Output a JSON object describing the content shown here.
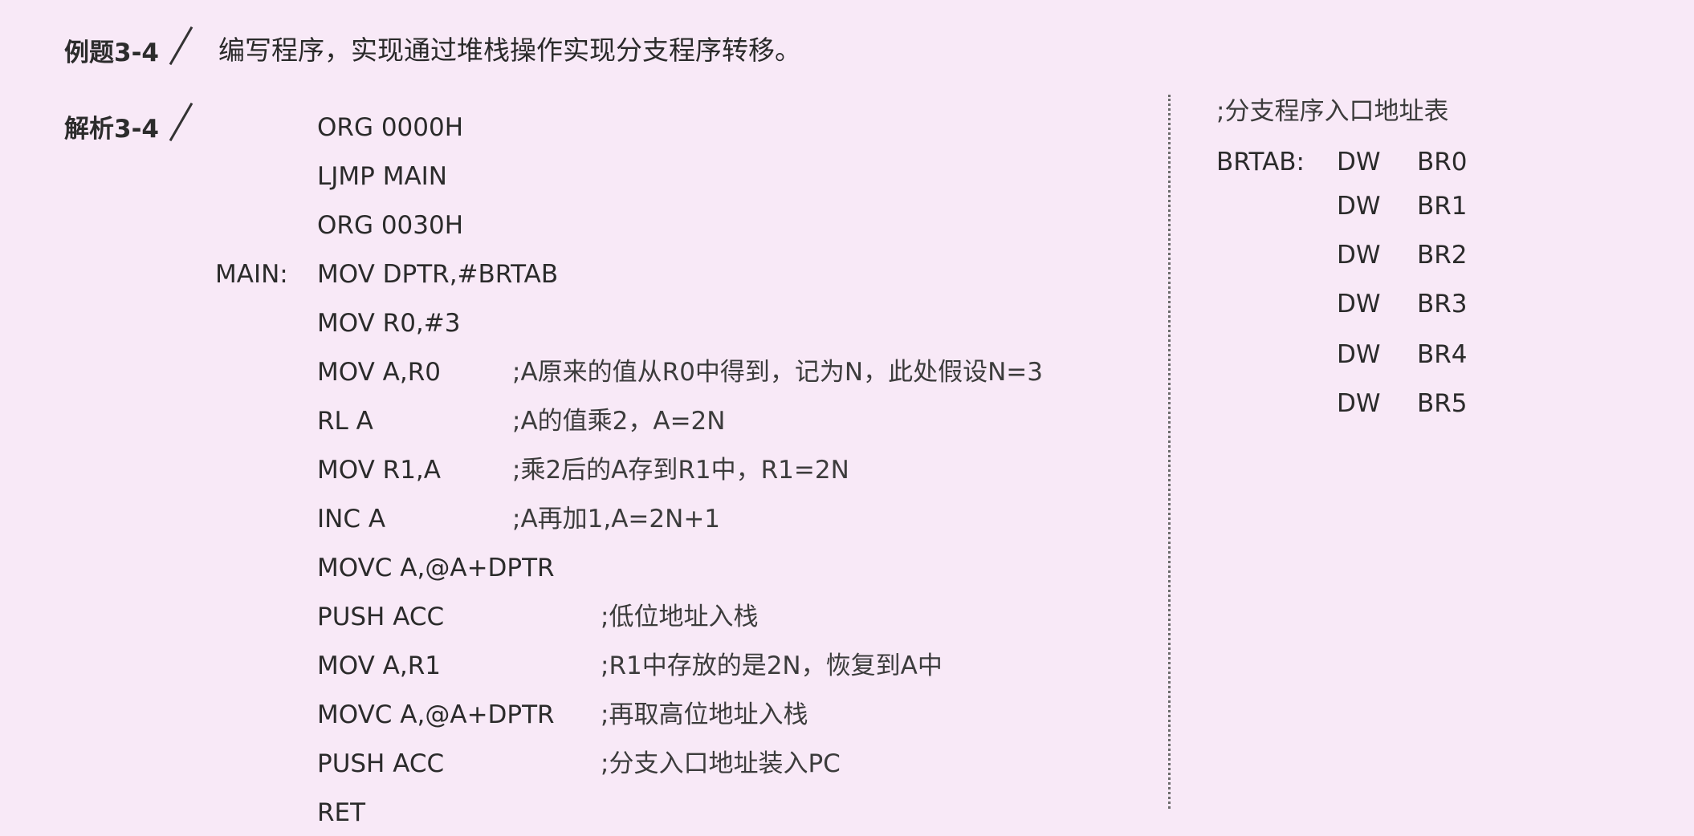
{
  "header": {
    "example_label": "例题3-4",
    "title": "编写程序，实现通过堆栈操作实现分支程序转移。"
  },
  "analysis": {
    "label": "解析3-4"
  },
  "program": {
    "lines": [
      {
        "label": "",
        "instr": "ORG 0000H",
        "comment": ""
      },
      {
        "label": "",
        "instr": "LJMP MAIN",
        "comment": ""
      },
      {
        "label": "",
        "instr": "ORG 0030H",
        "comment": ""
      },
      {
        "label": "MAIN:",
        "instr": "MOV DPTR,#BRTAB",
        "comment": ""
      },
      {
        "label": "",
        "instr": "MOV R0,#3",
        "comment": ""
      },
      {
        "label": "",
        "instr": "MOV A,R0",
        "comment": ";A原来的值从R0中得到，记为N，此处假设N=3"
      },
      {
        "label": "",
        "instr": "RL A",
        "comment": ";A的值乘2，A=2N"
      },
      {
        "label": "",
        "instr": "MOV R1,A",
        "comment": ";乘2后的A存到R1中，R1=2N"
      },
      {
        "label": "",
        "instr": "INC A",
        "comment": ";A再加1,A=2N+1"
      },
      {
        "label": "",
        "instr": "MOVC A,@A+DPTR",
        "comment": ""
      },
      {
        "label": "",
        "instr": "PUSH  ACC",
        "comment": ";低位地址入栈"
      },
      {
        "label": "",
        "instr": "MOV A,R1",
        "comment": ";R1中存放的是2N，恢复到A中"
      },
      {
        "label": "",
        "instr": "MOVC A,@A+DPTR",
        "comment": ";再取高位地址入栈"
      },
      {
        "label": "",
        "instr": "PUSH ACC",
        "comment": ";分支入口地址装入PC"
      },
      {
        "label": "",
        "instr": "RET",
        "comment": ""
      }
    ]
  },
  "table": {
    "comment": ";分支程序入口地址表",
    "label": "BRTAB:",
    "rows": [
      {
        "op": "DW",
        "arg": "BR0"
      },
      {
        "op": "DW",
        "arg": "BR1"
      },
      {
        "op": "DW",
        "arg": "BR2"
      },
      {
        "op": "DW",
        "arg": "BR3"
      },
      {
        "op": "DW",
        "arg": "BR4"
      },
      {
        "op": "DW",
        "arg": "BR5"
      }
    ]
  }
}
